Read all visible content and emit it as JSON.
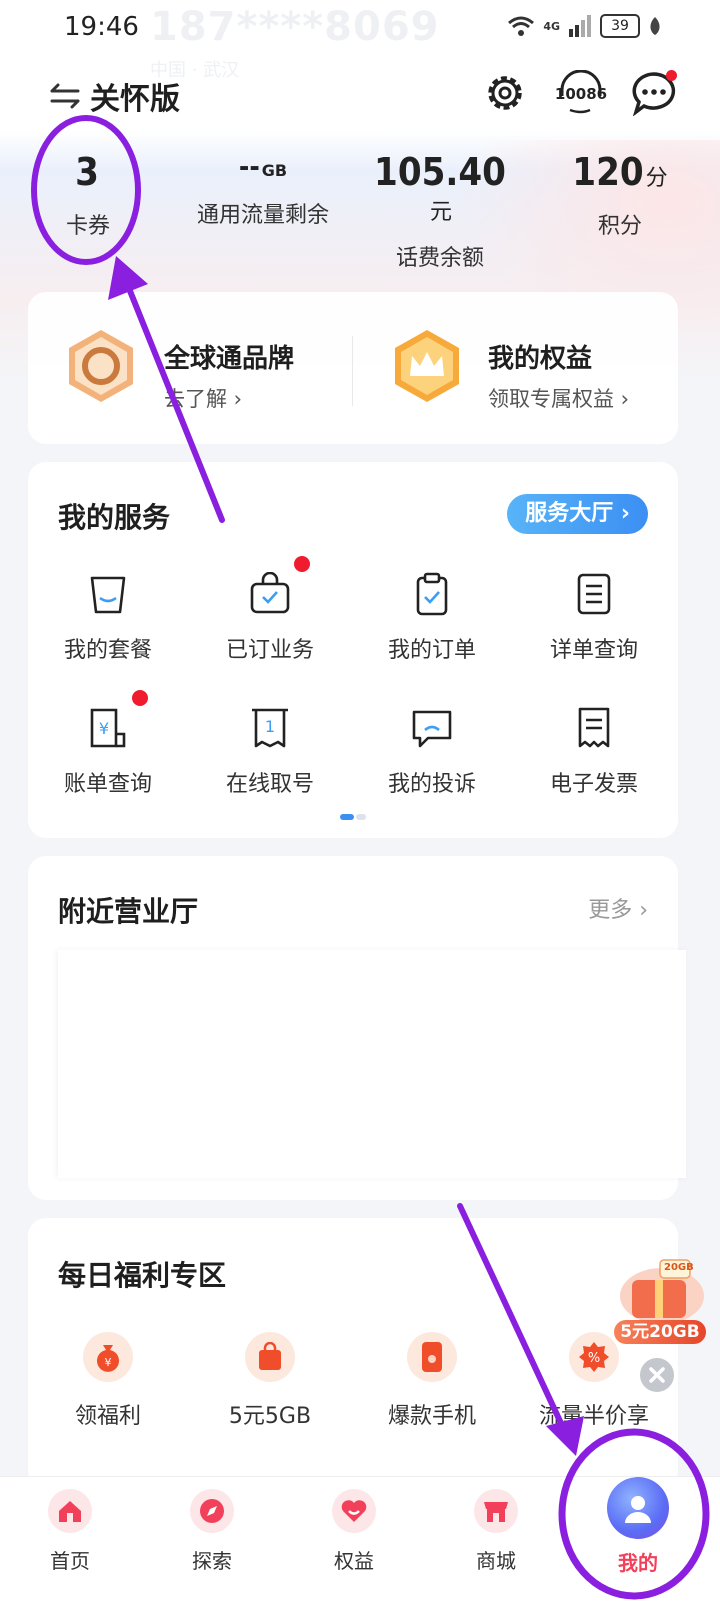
{
  "status_bar": {
    "time": "19:46",
    "masked_number": "187****8069",
    "location": "中国 · 武汉",
    "network": "4G",
    "battery": "39"
  },
  "header": {
    "care_mode_label": "关怀版",
    "hotline_label": "10086"
  },
  "stats": [
    {
      "value": "3",
      "unit": "",
      "label": "卡券"
    },
    {
      "value": "--",
      "unit": "GB",
      "label": "通用流量剩余"
    },
    {
      "value": "105.40",
      "unit": "元",
      "label": "话费余额"
    },
    {
      "value": "120",
      "unit": "分",
      "label": "积分"
    }
  ],
  "brand": {
    "left": {
      "title": "全球通品牌",
      "subtitle": "去了解 ›"
    },
    "right": {
      "title": "我的权益",
      "subtitle": "领取专属权益 ›"
    }
  },
  "services": {
    "title": "我的服务",
    "hall_button": "服务大厅 ›",
    "items": [
      {
        "label": "我的套餐",
        "icon": "bag-icon"
      },
      {
        "label": "已订业务",
        "icon": "subscribed-icon"
      },
      {
        "label": "我的订单",
        "icon": "clipboard-icon"
      },
      {
        "label": "详单查询",
        "icon": "list-icon"
      },
      {
        "label": "账单查询",
        "icon": "bill-icon"
      },
      {
        "label": "在线取号",
        "icon": "ticket-icon"
      },
      {
        "label": "我的投诉",
        "icon": "complaint-icon"
      },
      {
        "label": "电子发票",
        "icon": "invoice-icon"
      }
    ]
  },
  "nearby": {
    "title": "附近营业厅",
    "more": "更多 ›"
  },
  "welfare": {
    "title": "每日福利专区",
    "items": [
      {
        "label": "领福利",
        "icon": "money-bag-icon"
      },
      {
        "label": "5元5GB",
        "icon": "shopping-bag-icon"
      },
      {
        "label": "爆款手机",
        "icon": "phone-icon"
      },
      {
        "label": "流量半价享",
        "icon": "discount-icon"
      }
    ],
    "promo_badge": "5元20GB",
    "promo_tag": "20GB"
  },
  "tabbar": [
    {
      "label": "首页",
      "icon": "home-icon"
    },
    {
      "label": "探索",
      "icon": "compass-icon"
    },
    {
      "label": "权益",
      "icon": "heart-icon"
    },
    {
      "label": "商城",
      "icon": "store-icon"
    },
    {
      "label": "我的",
      "icon": "profile-icon"
    }
  ],
  "colors": {
    "accent_blue": "#3b8ff3",
    "badge_red": "#f11b30",
    "annotation_purple": "#8a1fe0"
  }
}
